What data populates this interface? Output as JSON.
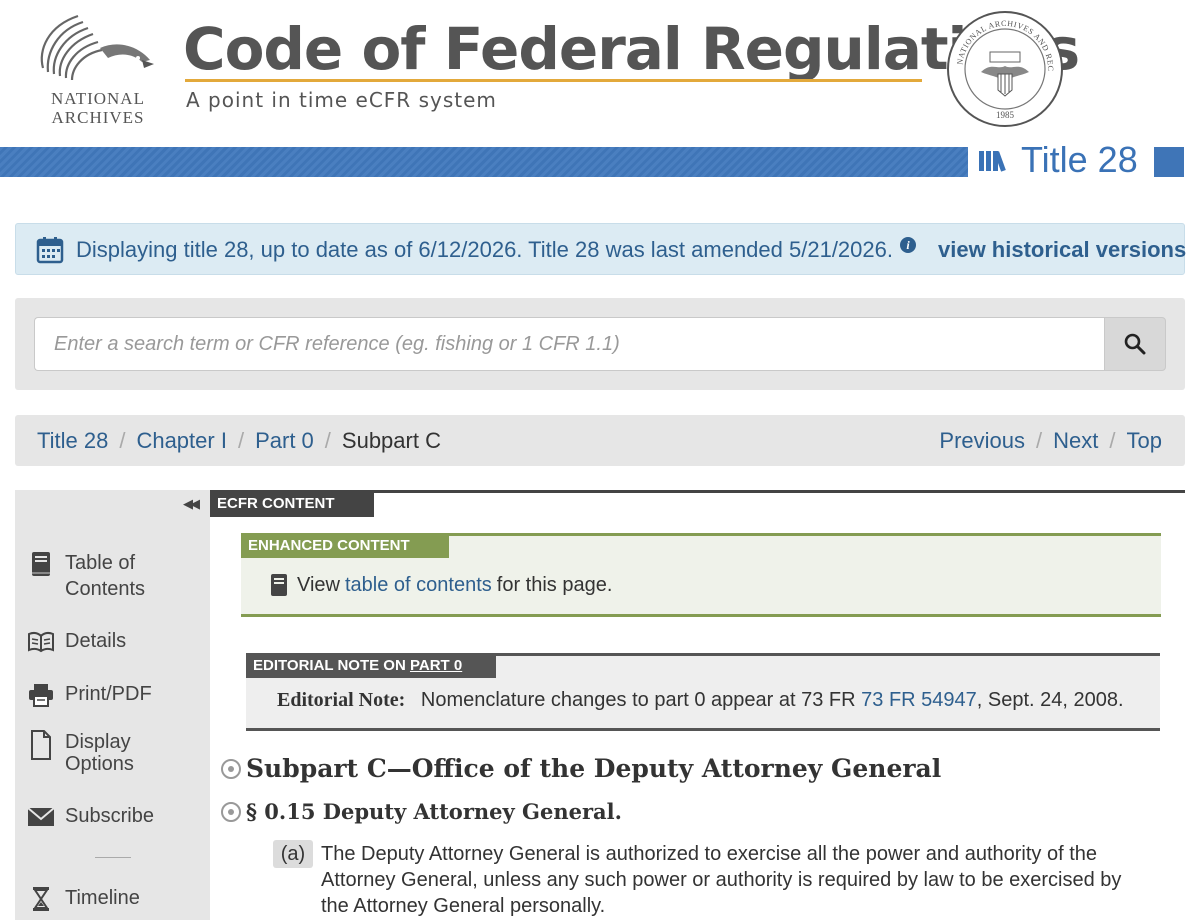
{
  "header": {
    "logo_text": "NATIONAL ARCHIVES",
    "logo_line1": "NATIONAL",
    "logo_line2": "ARCHIVES",
    "title": "Code of Federal Regulations",
    "subtitle": "A point in time eCFR system",
    "seal_text": "NATIONAL ARCHIVES AND RECORDS ADMINISTRATION",
    "seal_year": "1985"
  },
  "band": {
    "title": "Title 28",
    "icon": "books-icon",
    "color": "#3f75b7"
  },
  "info": {
    "icon": "calendar-icon",
    "message": "Displaying title 28, up to date as of 6/12/2026. Title 28 was last amended 5/21/2026.",
    "info_glyph": "i",
    "historical_link": "view historical versions"
  },
  "search": {
    "placeholder": "Enter a search term or CFR reference (eg. fishing or 1 CFR 1.1)",
    "icon": "search-icon"
  },
  "breadcrumb": {
    "items": [
      "Title 28",
      "Chapter I",
      "Part 0"
    ],
    "current": "Subpart C",
    "separator": "/",
    "nav": [
      "Previous",
      "Next",
      "Top"
    ]
  },
  "sidebar": {
    "collapse_glyph": "◀◀",
    "items": [
      {
        "label_1": "Table of",
        "label_2": "Contents",
        "icon": "book-icon"
      },
      {
        "label": "Details",
        "icon": "open-book-icon"
      },
      {
        "label": "Print/PDF",
        "icon": "printer-icon"
      },
      {
        "label_1": "Display",
        "label_2": "Options",
        "icon": "document-icon"
      },
      {
        "label": "Subscribe",
        "icon": "envelope-icon"
      },
      {
        "label": "Timeline",
        "icon": "hourglass-icon"
      }
    ]
  },
  "content": {
    "ecfr_tab": "ECFR CONTENT",
    "enhanced": {
      "tab": "ENHANCED CONTENT",
      "pre": "View",
      "link": "table of contents",
      "post": "for this page."
    },
    "editorial": {
      "tab_pre": "EDITORIAL NOTE ON",
      "tab_link": "PART 0",
      "label": "Editorial Note:",
      "text_pre": "Nomenclature changes to part 0 appear at 73 FR",
      "link": "73 FR 54947",
      "text_post": ", Sept. 24, 2008."
    },
    "subpart_heading": "Subpart C—Office of the Deputy Attorney General",
    "section_heading": "§ 0.15 Deputy Attorney General.",
    "paragraph": {
      "marker": "(a)",
      "text": "The Deputy Attorney General is authorized to exercise all the power and authority of the Attorney General, unless any such power or authority is required by law to be exercised by the Attorney General personally."
    }
  },
  "colors": {
    "accent_blue": "#2e5f8e",
    "title_rule": "#e3a93b",
    "enhanced_green": "#849c52",
    "dark_tab": "#444444"
  }
}
